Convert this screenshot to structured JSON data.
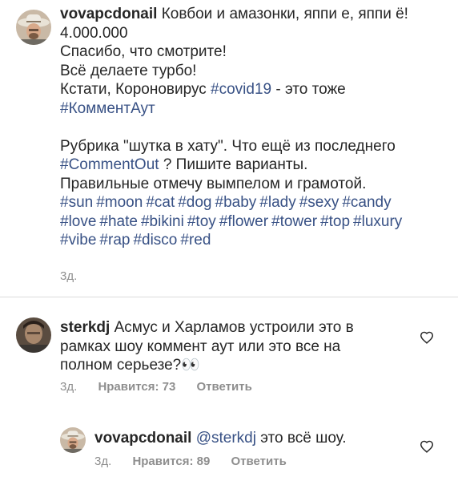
{
  "post": {
    "username": "vovapcdonail",
    "lines": [
      "Ковбои и амазонки, яппи е, яппи ё!",
      "4.000.000",
      "Спасибо, что смотрите!",
      "Всё делаете турбо!",
      "Кстати, Короновирус",
      "- это тоже"
    ],
    "covid_tag": "#covid19",
    "comment_out_tag_ru": "#КомментАут",
    "rubric_line": "Рубрика \"шутка в хату\". Что ещё из последнего",
    "comment_out_tag": "#CommentOut",
    "variants_text": "? Пишите варианты.",
    "award_line": "Правильные отмечу вымпелом и грамотой.",
    "hashtags_row1": [
      "#sun",
      "#moon",
      "#cat",
      "#dog",
      "#baby",
      "#lady",
      "#sexy",
      "#candy"
    ],
    "hashtags_row2": [
      "#love",
      "#hate",
      "#bikini",
      "#toy",
      "#flower",
      "#tower",
      "#top",
      "#luxury"
    ],
    "hashtags_row3": [
      "#vibe",
      "#rap",
      "#disco",
      "#red"
    ],
    "time": "3д."
  },
  "comment": {
    "username": "sterkdj",
    "line1": "Асмус и Харламов устроили это в",
    "line2": "рамках шоу коммент аут или это все на",
    "line3": "полном серьезе?",
    "emoji": "👀",
    "time": "3д.",
    "likes": "Нравится: 73",
    "reply": "Ответить"
  },
  "reply_comment": {
    "username": "vovapcdonail",
    "mention": "@sterkdj",
    "text": "это всё шоу.",
    "time": "3д.",
    "likes": "Нравится: 89",
    "reply": "Ответить"
  },
  "icons": {
    "heart": "heart-outline-icon"
  },
  "colors": {
    "link": "#385185",
    "muted": "#8e8e8e",
    "text": "#262626"
  }
}
